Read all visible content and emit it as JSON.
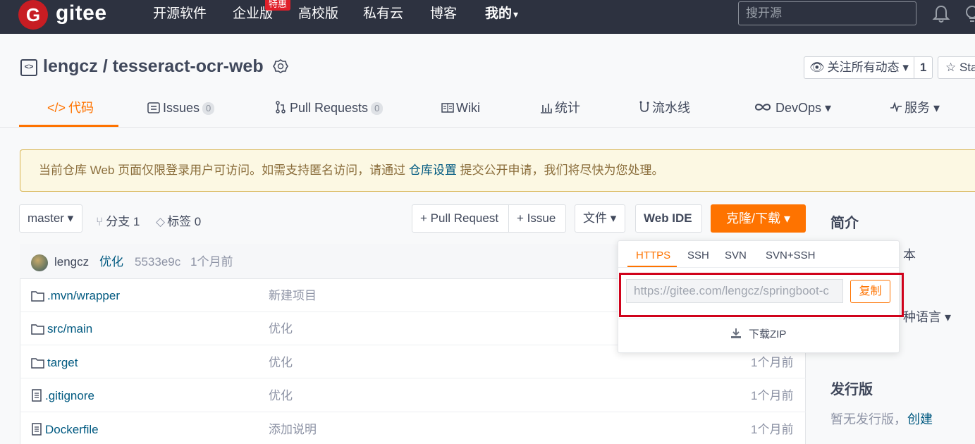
{
  "topnav": {
    "logo_mark": "G",
    "logo_text": "gitee",
    "items": [
      "开源软件",
      "企业版",
      "高校版",
      "私有云",
      "博客",
      "我的"
    ],
    "hot_badge": "特惠",
    "my_caret": "▾",
    "search_placeholder": "搜开源"
  },
  "repo": {
    "icon_text": "<>",
    "title": "lengcz / tesseract-ocr-web",
    "watch_label": "关注所有动态 ▾",
    "watch_count": "1",
    "star_label": "☆ Sta"
  },
  "tabs": [
    {
      "label": "代码",
      "icon": "</>"
    },
    {
      "label": "Issues",
      "count": "0"
    },
    {
      "label": "Pull Requests",
      "count": "0"
    },
    {
      "label": "Wiki"
    },
    {
      "label": "统计"
    },
    {
      "label": "流水线"
    },
    {
      "label": "DevOps ▾"
    },
    {
      "label": "服务 ▾"
    }
  ],
  "notice": {
    "text_before": "当前仓库 Web 页面仅限登录用户可访问。如需支持匿名访问，请通过 ",
    "link": "仓库设置",
    "text_after": " 提交公开申请，我们将尽快为您处理。"
  },
  "toolbar": {
    "branch": "master ▾",
    "branches": "分支 1",
    "tags": "标签 0",
    "pull_request": "+ Pull Request",
    "issue": "+ Issue",
    "file": "文件 ▾",
    "web_ide": "Web IDE",
    "clone": "克隆/下载 ▾"
  },
  "commit": {
    "author": "lengcz",
    "message": "优化",
    "hash": "5533e9c",
    "time": "1个月前"
  },
  "files": [
    {
      "name": ".mvn/wrapper",
      "type": "folder",
      "message": "新建项目",
      "time": ""
    },
    {
      "name": "src/main",
      "type": "folder",
      "message": "优化",
      "time": ""
    },
    {
      "name": "target",
      "type": "folder",
      "message": "优化",
      "time": "1个月前"
    },
    {
      "name": ".gitignore",
      "type": "file",
      "message": "优化",
      "time": "1个月前"
    },
    {
      "name": "Dockerfile",
      "type": "file",
      "message": "添加说明",
      "time": "1个月前"
    }
  ],
  "sidebar": {
    "intro_title": "简介",
    "intro_partial": "本",
    "lang_partial": "种语言 ▾",
    "release_title": "发行版",
    "release_text": "暂无发行版，",
    "release_link": "创建"
  },
  "clone_dropdown": {
    "tabs": [
      "HTTPS",
      "SSH",
      "SVN",
      "SVN+SSH"
    ],
    "active_tab": "HTTPS",
    "url": "https://gitee.com/lengcz/springboot-c",
    "copy_label": "复制",
    "download_zip": "下载ZIP"
  },
  "colors": {
    "accent": "#fe7300",
    "nav_bg": "#2d3240",
    "brand_red": "#c71d23",
    "highlight_box": "#d0021b"
  }
}
